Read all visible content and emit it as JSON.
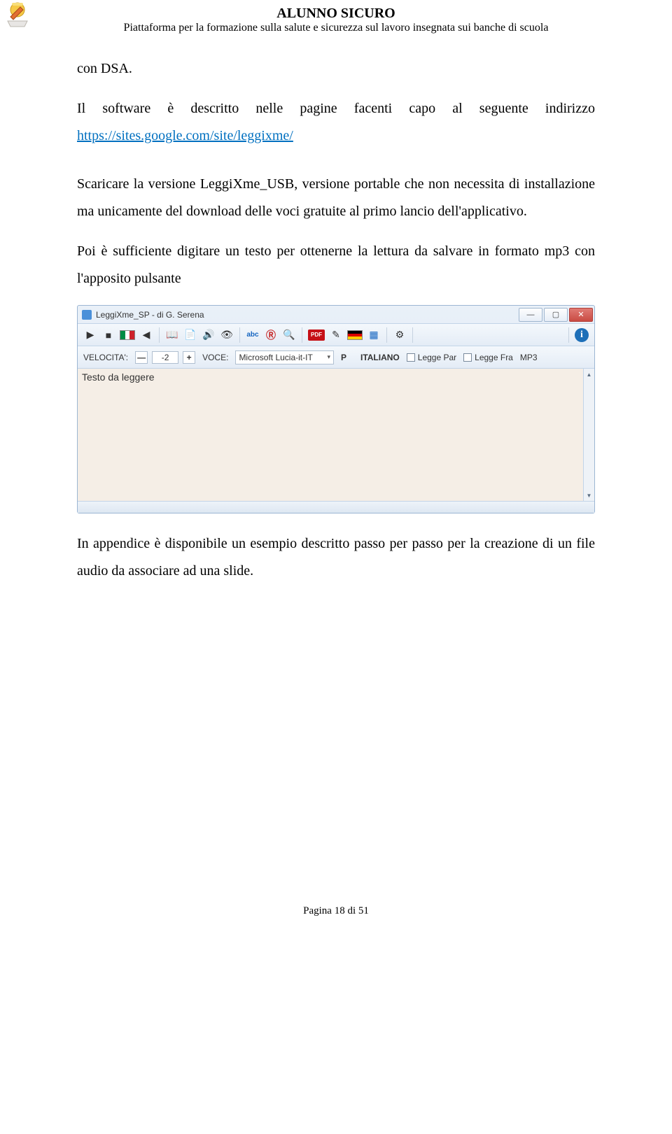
{
  "header": {
    "title": "ALUNNO SICURO",
    "subtitle": "Piattaforma per la formazione sulla salute e sicurezza sul lavoro insegnata sui banche di scuola"
  },
  "body": {
    "p1_prefix": "con DSA.",
    "p2_text": "Il software è descritto nelle pagine facenti capo al seguente indirizzo ",
    "p2_link": "https://sites.google.com/site/leggixme/",
    "p3": "Scaricare la versione LeggiXme_USB, versione portable che non necessita di installazione ma unicamente del download delle voci gratuite al primo lancio dell'applicativo.",
    "p4": "Poi è sufficiente digitare un testo per ottenerne la lettura da salvare in formato mp3 con l'apposito pulsante",
    "p5": "In appendice è disponibile un esempio descritto passo per passo per la creazione di un file audio da associare ad una slide."
  },
  "app": {
    "window_title": "LeggiXme_SP - di G. Serena",
    "speed_label": "VELOCITA':",
    "speed_value": "-2",
    "voice_label": "VOCE:",
    "voice_value": "Microsoft Lucia-it-IT",
    "p_label": "P",
    "lang_label": "ITALIANO",
    "legge_par_label": "Legge Par",
    "legge_fra_label": "Legge Fra",
    "mp3_label": "MP3",
    "textarea_value": "Testo da leggere"
  },
  "footer": {
    "page_label": "Pagina 18 di 51"
  }
}
